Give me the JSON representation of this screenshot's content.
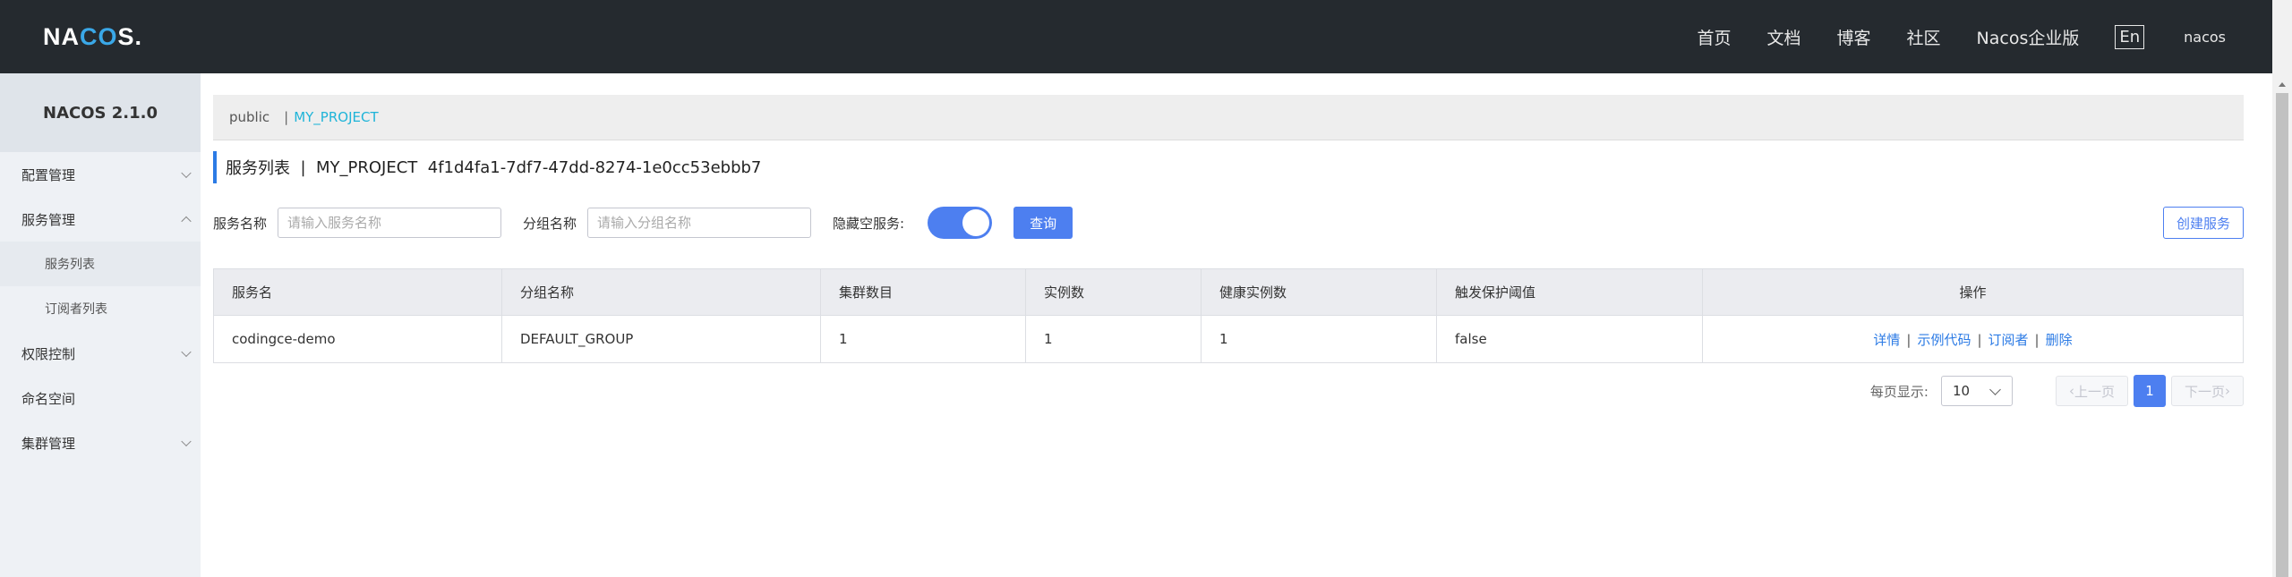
{
  "header": {
    "logo_parts": [
      "NA",
      "C",
      "O",
      "S."
    ],
    "nav": [
      "首页",
      "文档",
      "博客",
      "社区",
      "Nacos企业版"
    ],
    "lang": "En",
    "user": "nacos"
  },
  "sidebar": {
    "version": "NACOS 2.1.0",
    "items": [
      {
        "label": "配置管理",
        "chevron": "down"
      },
      {
        "label": "服务管理",
        "chevron": "up"
      },
      {
        "label": "服务列表"
      },
      {
        "label": "订阅者列表"
      },
      {
        "label": "权限控制",
        "chevron": "down"
      },
      {
        "label": "命名空间"
      },
      {
        "label": "集群管理",
        "chevron": "down"
      }
    ]
  },
  "namespaces": [
    "public",
    "|",
    "MY_PROJECT"
  ],
  "title": {
    "main": "服务列表",
    "sep": "|",
    "ns": "MY_PROJECT",
    "id": "4f1d4fa1-7df7-47dd-8274-1e0cc53ebbb7"
  },
  "search": {
    "service_label": "服务名称",
    "service_placeholder": "请输入服务名称",
    "group_label": "分组名称",
    "group_placeholder": "请输入分组名称",
    "hide_empty_label": "隐藏空服务:",
    "query_button": "查询",
    "create_button": "创建服务"
  },
  "table": {
    "columns": [
      "服务名",
      "分组名称",
      "集群数目",
      "实例数",
      "健康实例数",
      "触发保护阈值",
      "操作"
    ],
    "rows": [
      [
        "codingce-demo",
        "DEFAULT_GROUP",
        "1",
        "1",
        "1",
        "false"
      ]
    ],
    "actions": [
      "详情",
      "示例代码",
      "订阅者",
      "删除"
    ],
    "action_sep": "|"
  },
  "pagination": {
    "page_size_label": "每页显示:",
    "page_size": "10",
    "prev": "上一页",
    "next": "下一页",
    "current": "1"
  },
  "colors": {
    "topbar": "#252a2f",
    "primary": "#4d7ff0",
    "link": "#2c7be5",
    "active_ns": "#1fb4d8"
  }
}
